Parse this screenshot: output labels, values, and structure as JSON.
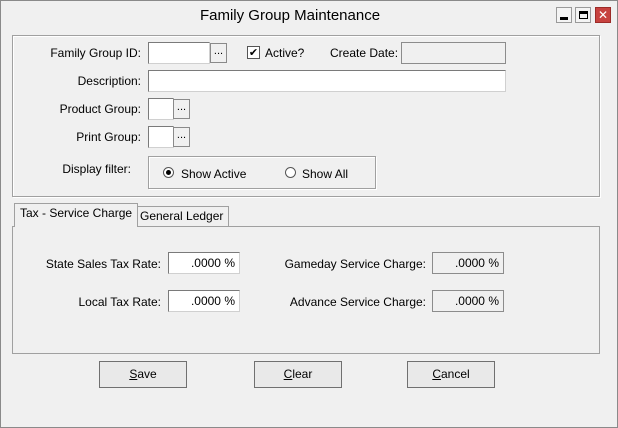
{
  "window": {
    "title": "Family Group Maintenance",
    "controls": {
      "minimize": "minimize-icon",
      "maximize": "maximize-icon",
      "close": "close-icon"
    }
  },
  "form": {
    "family_group_id_label": "Family Group ID:",
    "family_group_id_value": "",
    "ellipsis": "...",
    "active_label": "Active?",
    "active_checked": true,
    "active_mark": "✔",
    "create_date_label": "Create Date:",
    "create_date_value": "",
    "description_label": "Description:",
    "description_value": "",
    "product_group_label": "Product Group:",
    "product_group_value": "",
    "print_group_label": "Print Group:",
    "print_group_value": "",
    "display_filter_label": "Display filter:",
    "filter_options": [
      "Show Active",
      "Show All"
    ],
    "filter_selected": "Show Active"
  },
  "tabs": [
    {
      "label": "Tax - Service Charge",
      "active": true
    },
    {
      "label": "General Ledger",
      "active": false
    }
  ],
  "tax": {
    "state_sales_tax_label": "State Sales Tax Rate:",
    "state_sales_tax_value": ".0000 %",
    "local_tax_label": "Local Tax Rate:",
    "local_tax_value": ".0000 %",
    "gameday_service_label": "Gameday Service Charge:",
    "gameday_service_value": ".0000 %",
    "advance_service_label": "Advance Service Charge:",
    "advance_service_value": ".0000 %"
  },
  "buttons": {
    "save": {
      "underline": "S",
      "rest": "ave"
    },
    "clear": {
      "underline": "C",
      "rest": "lear"
    },
    "cancel": {
      "underline": "C",
      "rest": "ancel"
    }
  }
}
